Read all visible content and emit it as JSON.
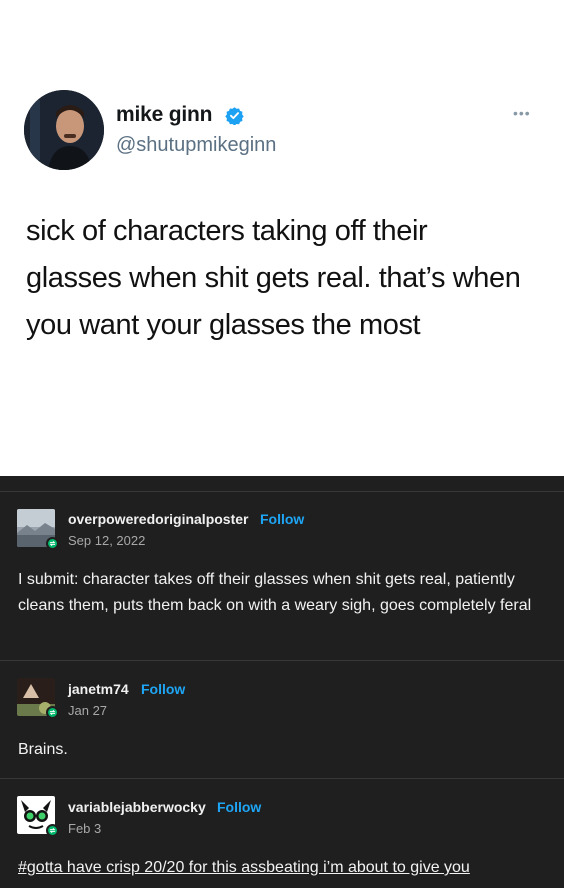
{
  "tweet": {
    "author_name": "mike ginn",
    "author_handle": "@shutupmikeginn",
    "more_icon": "ellipsis-icon",
    "verified_icon": "verified-badge-icon",
    "text": "sick of characters taking off their glasses when shit gets real. that’s when you want your glasses the most"
  },
  "thread": {
    "follow_label": "Follow",
    "posts": [
      {
        "username": "overpoweredoriginalposter",
        "date": "Sep 12, 2022",
        "body": "I submit: character takes off their glasses when shit gets real, patiently cleans them, puts them back on with a weary sigh, goes completely feral"
      },
      {
        "username": "janetm74",
        "date": "Jan 27",
        "body": "Brains."
      },
      {
        "username": "variablejabberwocky",
        "date": "Feb 3",
        "tag": "#gotta have crisp 20/20 for this assbeating i’m about to give you"
      }
    ]
  },
  "colors": {
    "tweet_background": "#ffffff",
    "thread_background": "#1f1f1f",
    "follow_link": "#1ea6f5",
    "reblog_badge": "#00b86b",
    "verified_badge": "#1da1f2"
  }
}
